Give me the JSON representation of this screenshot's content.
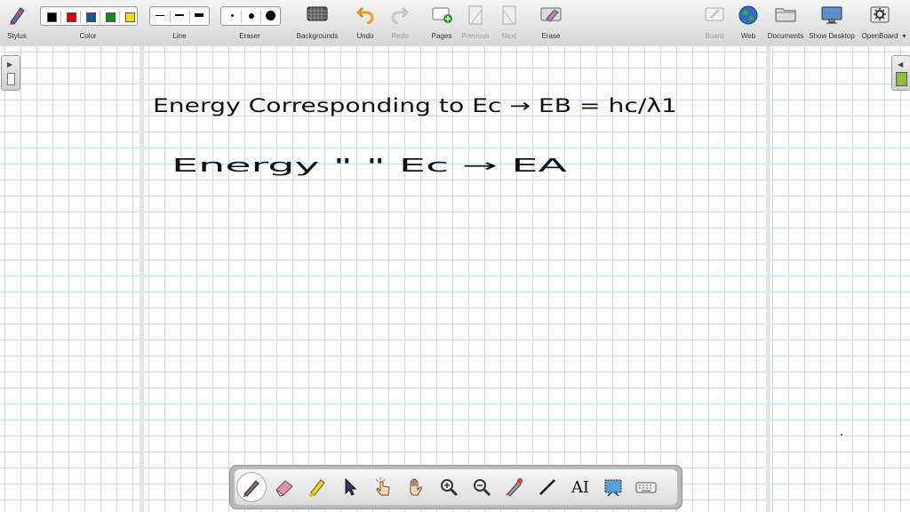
{
  "toolbar": {
    "stylus": "Stylus",
    "color": "Color",
    "line": "Line",
    "eraser": "Eraser",
    "backgrounds": "Backgrounds",
    "undo": "Undo",
    "redo": "Redo",
    "pages": "Pages",
    "previous": "Previous",
    "next": "Next",
    "erase": "Erase",
    "board": "Board",
    "web": "Web",
    "documents": "Documents",
    "show_desktop": "Show Desktop",
    "openboard": "OpenBoard"
  },
  "colors": {
    "swatches": [
      "#000000",
      "#e00000",
      "#1f4f9a",
      "#0d8a22",
      "#f2df00"
    ],
    "grid": "#c7dcec",
    "ink": "#111111"
  },
  "handwriting": {
    "line1": "Energy Corresponding to Ec → EB = hc/λ1",
    "line2": "Energy \" \" Ec → EA"
  },
  "palette_tools": [
    "pen-icon",
    "eraser-icon",
    "marker-icon",
    "selector-icon",
    "interactive-pointer-icon",
    "hand-icon",
    "zoom-in-icon",
    "zoom-out-icon",
    "laser-pointer-icon",
    "line-icon",
    "text-icon",
    "capture-icon",
    "keyboard-icon"
  ],
  "text_tool_label": "AI"
}
